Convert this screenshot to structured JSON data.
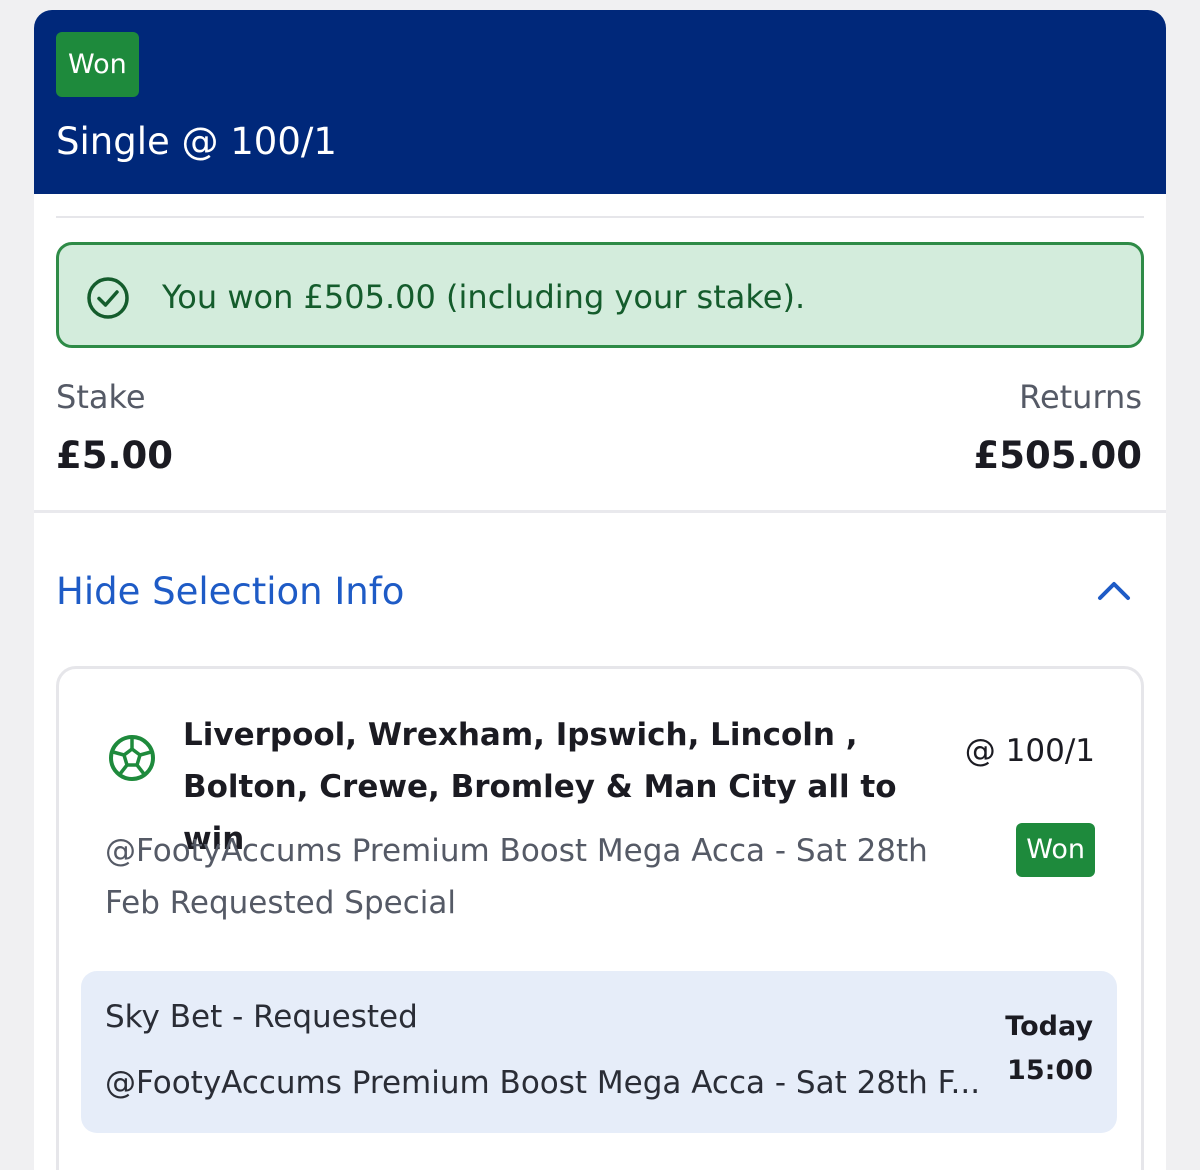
{
  "header": {
    "status_badge": "Won",
    "title": "Single @ 100/1",
    "color": "#00287a"
  },
  "banner": {
    "icon": "check-circle-icon",
    "text": "You won £505.00 (including your stake).",
    "color": "#d3ecdc"
  },
  "summary": {
    "stake_label": "Stake",
    "stake_value": "£5.00",
    "returns_label": "Returns",
    "returns_value": "£505.00"
  },
  "toggle": {
    "label": "Hide Selection Info",
    "icon": "chevron-up-icon"
  },
  "selection": {
    "icon": "football-icon",
    "name": "Liverpool, Wrexham, Ipswich, Lincoln , Bolton, Crewe, Bromley & Man City all to win",
    "odds": "@ 100/1",
    "market": "@FootyAccums Premium Boost Mega Acca - Sat 28th Feb Requested Special",
    "status": "Won",
    "event": {
      "name": "Sky Bet - Requested",
      "market": "@FootyAccums Premium Boost Mega Acca - Sat 28th F...",
      "day": "Today",
      "time": "15:00"
    }
  }
}
